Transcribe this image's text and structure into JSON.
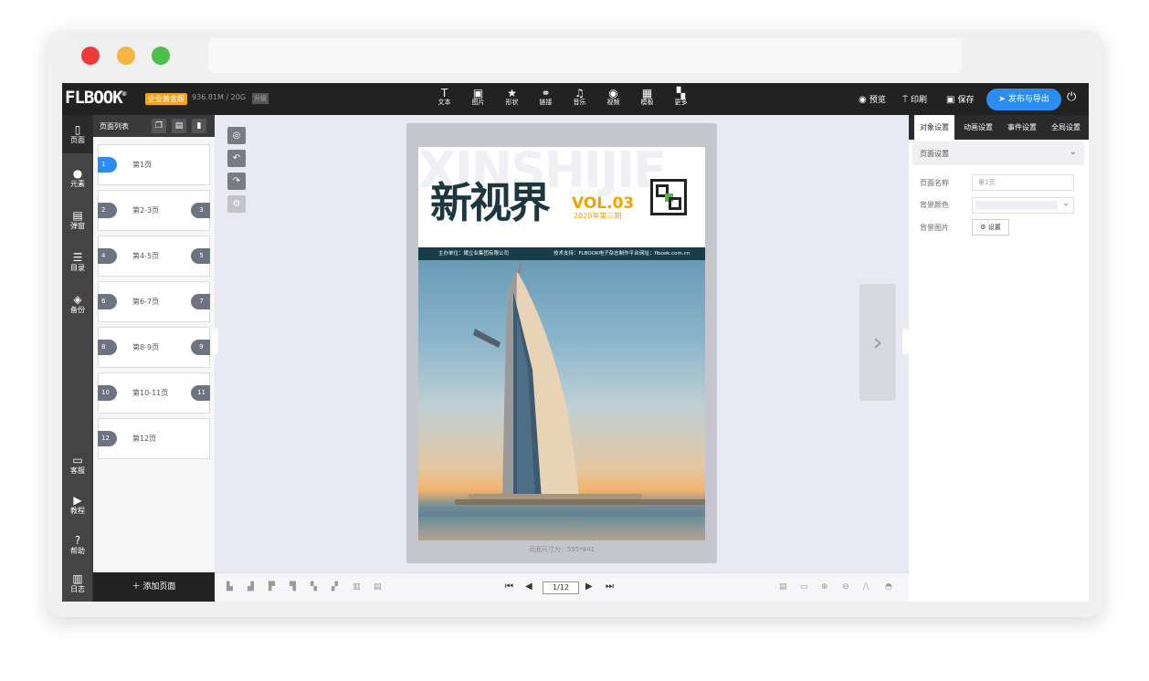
{
  "topbar": {
    "logo": "FLBOOK",
    "logo_mark": "®",
    "edition": "企业黄金版",
    "quota": "936.81M / 20G",
    "upgrade": "升级",
    "tools": [
      {
        "label": "文本",
        "icon": "text-icon",
        "glyph": "T"
      },
      {
        "label": "图片",
        "icon": "image-icon",
        "glyph": "▣"
      },
      {
        "label": "形状",
        "icon": "star-icon",
        "glyph": "★"
      },
      {
        "label": "链接",
        "icon": "link-icon",
        "glyph": "⚭"
      },
      {
        "label": "音乐",
        "icon": "music-icon",
        "glyph": "♫"
      },
      {
        "label": "视频",
        "icon": "video-icon",
        "glyph": "◉"
      },
      {
        "label": "模板",
        "icon": "template-icon",
        "glyph": "▦"
      },
      {
        "label": "更多",
        "icon": "more-icon",
        "glyph": "▚"
      }
    ],
    "preview": "预览",
    "print": "印刷",
    "save": "保存",
    "publish": "发布与导出"
  },
  "leftnav": {
    "items": [
      {
        "label": "页面",
        "icon": "page-icon",
        "glyph": "▯"
      },
      {
        "label": "元素",
        "icon": "element-icon",
        "glyph": "●"
      },
      {
        "label": "弹窗",
        "icon": "popup-icon",
        "glyph": "▤"
      },
      {
        "label": "目录",
        "icon": "catalog-icon",
        "glyph": "☰"
      },
      {
        "label": "备份",
        "icon": "backup-icon",
        "glyph": "◈"
      },
      {
        "label": "客服",
        "icon": "service-icon",
        "glyph": "▭"
      },
      {
        "label": "教程",
        "icon": "tutorial-icon",
        "glyph": "▶"
      },
      {
        "label": "帮助",
        "icon": "help-icon",
        "glyph": "?"
      },
      {
        "label": "日志",
        "icon": "log-icon",
        "glyph": "▥"
      }
    ]
  },
  "pages": {
    "title": "页面列表",
    "add": "添加页面",
    "items": [
      {
        "n1": "1",
        "n2": "",
        "label": "第1页"
      },
      {
        "n1": "2",
        "n2": "3",
        "label": "第2-3页"
      },
      {
        "n1": "4",
        "n2": "5",
        "label": "第4-5页"
      },
      {
        "n1": "6",
        "n2": "7",
        "label": "第6-7页"
      },
      {
        "n1": "8",
        "n2": "9",
        "label": "第8-9页"
      },
      {
        "n1": "10",
        "n2": "11",
        "label": "第10-11页"
      },
      {
        "n1": "12",
        "n2": "",
        "label": "第12页"
      }
    ]
  },
  "cover": {
    "watermark": "XINSHIJIE",
    "title": "新视界",
    "vol": "VOL.03",
    "issue": "2020年第三期",
    "host": "主办单位：爾立业集团有限公司",
    "tech": "技术支持：FLBOOK电子杂志制作平台",
    "site": "网址：flbook.com.cn"
  },
  "canvas": {
    "size_text": "页面尺寸为：595*841"
  },
  "pager": {
    "current": "1/12"
  },
  "rpanel": {
    "tabs": [
      "对象设置",
      "动画设置",
      "事件设置",
      "全局设置"
    ],
    "section": "页面设置",
    "name_label": "页面名称",
    "name_placeholder": "第1页",
    "bg_color_label": "背景颜色",
    "bg_image_label": "背景图片",
    "set_button": "设置"
  }
}
